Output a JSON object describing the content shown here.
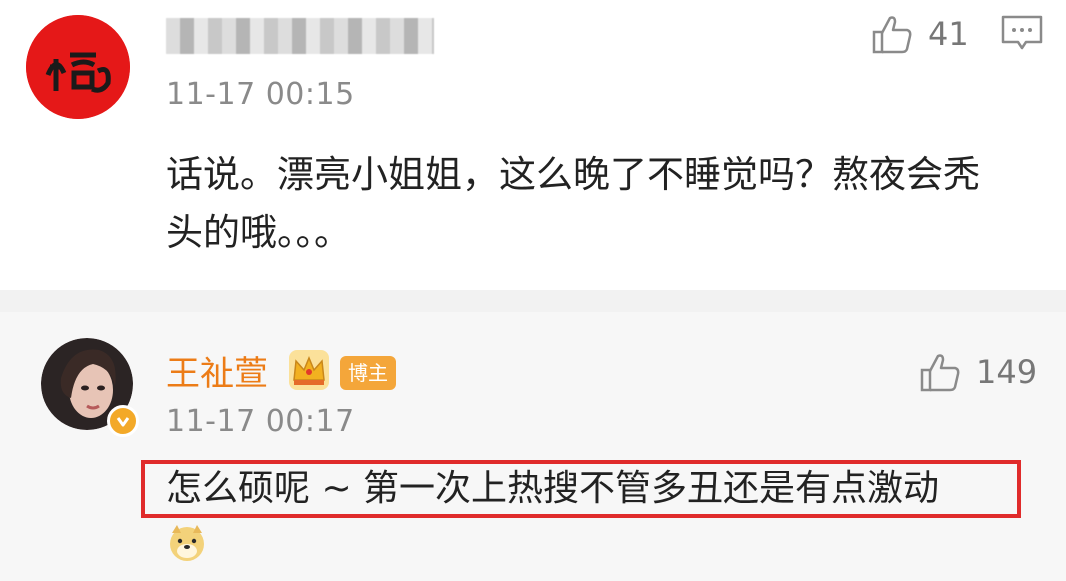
{
  "comments": [
    {
      "time": "11-17 00:15",
      "likes": "41",
      "text": "话说。漂亮小姐姐，这么晚了不睡觉吗？熬夜会秃头的哦。。。"
    },
    {
      "author": "王祉萱",
      "badge": "博主",
      "time": "11-17 00:17",
      "likes": "149",
      "text": "怎么硕呢 ~ 第一次上热搜不管多丑还是有点激动"
    }
  ],
  "icons": {
    "like": "thumbs-up-icon",
    "reply": "comment-icon",
    "crown": "crown-icon",
    "emoji": "doge-emoji-icon",
    "verified": "verified-badge-icon"
  },
  "colors": {
    "author_name": "#ec7c17",
    "highlight_border": "#e02b2b",
    "badge_bg": "#f4a63a",
    "avatar1_bg": "#e51818"
  }
}
